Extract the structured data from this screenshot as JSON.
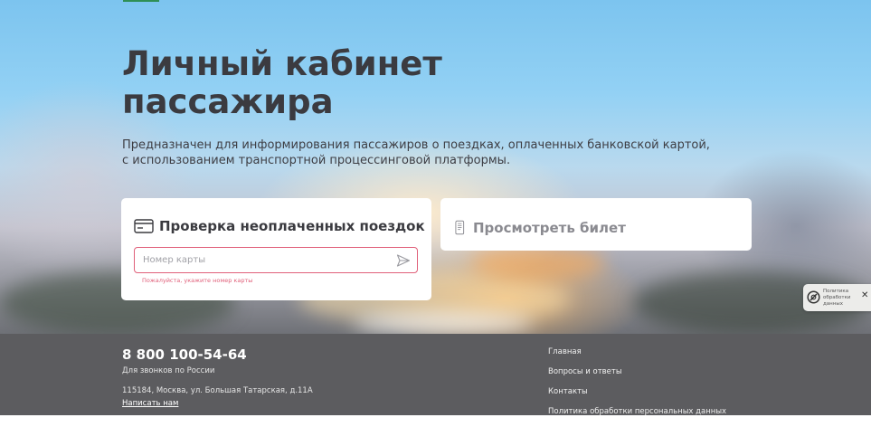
{
  "hero": {
    "title_line1": "Личный кабинет",
    "title_line2": "пассажира",
    "subtitle": "Предназначен для информирования пассажиров о поездках, оплаченных банковской картой, с использованием транспортной процессинговой платформы."
  },
  "check_card": {
    "title": "Проверка неоплаченных поездок",
    "input_placeholder": "Номер карты",
    "input_value": "",
    "error": "Пожалуйста, укажите номер карты"
  },
  "ticket_card": {
    "title": "Просмотреть билет"
  },
  "cookie_badge": {
    "line1": "Политика",
    "line2": "обработки",
    "line3": "данных"
  },
  "footer": {
    "phone": "8 800 100-54-64",
    "phone_note": "Для звонков по России",
    "address": "115184, Москва, ул. Большая Татарская, д.11А",
    "write_link": "Написать нам",
    "nav": [
      "Главная",
      "Вопросы и ответы",
      "Контакты",
      "Политика обработки персональных данных"
    ]
  },
  "colors": {
    "accent_green": "#2f8f55",
    "error_pink": "#e0607a",
    "footer_bg": "#5c5c5f",
    "title_text": "#3b3b40"
  },
  "icons": {
    "card": "credit-card-icon",
    "ticket": "ticket-icon",
    "send": "send-icon",
    "cookie": "privacy-icon",
    "close": "close-icon"
  }
}
